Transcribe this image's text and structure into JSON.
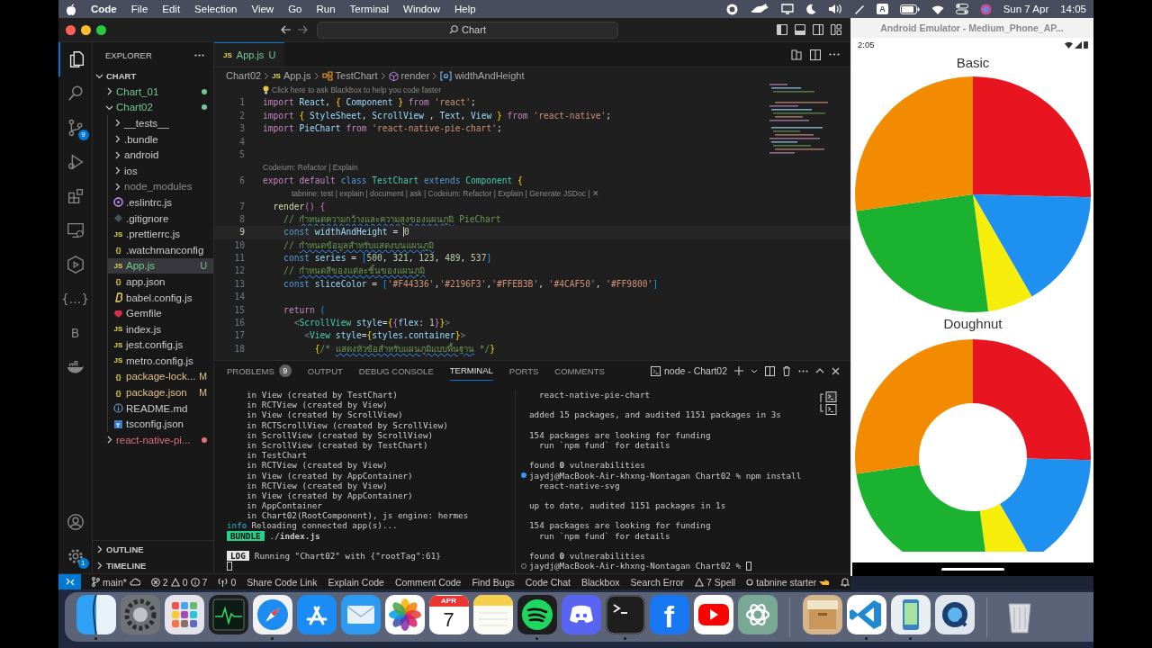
{
  "menu_bar": {
    "app": "Code",
    "items": [
      "File",
      "Edit",
      "Selection",
      "View",
      "Go",
      "Run",
      "Terminal",
      "Window",
      "Help"
    ],
    "input_source": "A",
    "date": "Sun 7 Apr",
    "time": "14:05"
  },
  "vscode": {
    "title_bar": {
      "search": "Chart"
    },
    "activity_bar": [
      {
        "kind": "explorer",
        "selected": true
      },
      {
        "kind": "search",
        "selected": false
      },
      {
        "kind": "source-control",
        "selected": false,
        "badge": "9"
      },
      {
        "kind": "run",
        "selected": false
      },
      {
        "kind": "extensions",
        "selected": false
      },
      {
        "kind": "remote",
        "selected": false
      },
      {
        "kind": "hexagon",
        "selected": false
      },
      {
        "kind": "glyph",
        "glyph": "{...}",
        "selected": false
      },
      {
        "kind": "glyph",
        "glyph": "B",
        "selected": false
      },
      {
        "kind": "docker",
        "selected": false
      }
    ],
    "activity_bottom": [
      {
        "kind": "account"
      },
      {
        "kind": "settings",
        "badge": "1"
      }
    ],
    "explorer": {
      "title": "EXPLORER",
      "section": "CHART",
      "tree": [
        {
          "label": "Chart_01",
          "kind": "folder",
          "expanded": false,
          "selected": false,
          "color": "#73c991",
          "dot": true
        },
        {
          "label": "Chart02",
          "kind": "folder",
          "expanded": true,
          "selected": false,
          "color": "#73c991",
          "dot": true,
          "children": [
            {
              "label": "__tests__",
              "kind": "folder",
              "expanded": false,
              "selected": false,
              "dot": false
            },
            {
              "label": ".bundle",
              "kind": "folder",
              "expanded": false,
              "selected": false,
              "dot": false
            },
            {
              "label": "android",
              "kind": "folder",
              "expanded": false,
              "selected": false,
              "dot": false
            },
            {
              "label": "ios",
              "kind": "folder",
              "expanded": false,
              "selected": false,
              "dot": false
            },
            {
              "label": "node_modules",
              "kind": "folder",
              "expanded": false,
              "selected": false,
              "color": "#8c8c8c",
              "dot": false
            },
            {
              "label": ".eslintrc.js",
              "kind": "eslint",
              "selected": false
            },
            {
              "label": ".gitignore",
              "kind": "gitignore",
              "selected": false
            },
            {
              "label": ".prettierrc.js",
              "kind": "js",
              "icon": "JS",
              "selected": false
            },
            {
              "label": ".watchmanconfig",
              "kind": "json",
              "icon": "{}",
              "selected": false
            },
            {
              "label": "App.js",
              "kind": "js",
              "icon": "JS",
              "selected": true,
              "color": "#73c991",
              "badge": "U"
            },
            {
              "label": "app.json",
              "kind": "json",
              "icon": "{}",
              "selected": false
            },
            {
              "label": "babel.config.js",
              "kind": "babel",
              "selected": false
            },
            {
              "label": "Gemfile",
              "kind": "gem",
              "selected": false
            },
            {
              "label": "index.js",
              "kind": "js",
              "icon": "JS",
              "selected": false
            },
            {
              "label": "jest.config.js",
              "kind": "js",
              "icon": "JS",
              "selected": false
            },
            {
              "label": "metro.config.js",
              "kind": "js",
              "icon": "JS",
              "selected": false
            },
            {
              "label": "package-lock...",
              "kind": "json",
              "icon": "{}",
              "selected": false,
              "color": "#e2c08d",
              "badge": "M"
            },
            {
              "label": "package.json",
              "kind": "json",
              "icon": "{}",
              "selected": false,
              "color": "#e2c08d",
              "badge": "M"
            },
            {
              "label": "README.md",
              "kind": "info",
              "selected": false
            },
            {
              "label": "tsconfig.json",
              "kind": "ts",
              "selected": false
            }
          ]
        },
        {
          "label": "react-native-pi...",
          "kind": "folder",
          "expanded": false,
          "selected": false,
          "color": "#e0707a",
          "dot": true
        }
      ],
      "bottom_sections": [
        {
          "label": "OUTLINE",
          "expanded": false
        },
        {
          "label": "TIMELINE",
          "expanded": false
        }
      ]
    },
    "editor": {
      "tabs": [
        {
          "label": "App.js",
          "icon": "JS",
          "badge": "U",
          "selected": true
        }
      ],
      "breadcrumb": [
        {
          "label": "Chart02",
          "kind": "folder"
        },
        {
          "label": "App.js",
          "kind": "js",
          "icon": "JS"
        },
        {
          "label": "TestChart",
          "kind": "class"
        },
        {
          "label": "render",
          "kind": "method"
        },
        {
          "label": "widthAndHeight",
          "kind": "variable"
        }
      ],
      "lines": [
        {
          "kind": "hint",
          "text": "Click here to ask Blackbox to help you code faster"
        },
        {
          "kind": "code",
          "number": "1",
          "current": false,
          "tokens": [
            {
              "kind": "kw",
              "text": "import"
            },
            {
              "kind": "id",
              "text": " React"
            },
            {
              "kind": "p",
              "text": ", "
            },
            {
              "kind": "b1",
              "text": "{"
            },
            {
              "kind": "id",
              "text": " Component "
            },
            {
              "kind": "b1",
              "text": "}"
            },
            {
              "kind": "kw",
              "text": " from "
            },
            {
              "kind": "str",
              "text": "'react'"
            },
            {
              "kind": "p",
              "text": ";"
            }
          ]
        },
        {
          "kind": "code",
          "number": "2",
          "current": false,
          "tokens": [
            {
              "kind": "kw",
              "text": "import "
            },
            {
              "kind": "b1",
              "text": "{"
            },
            {
              "kind": "id",
              "text": " StyleSheet"
            },
            {
              "kind": "p",
              "text": ", "
            },
            {
              "kind": "id",
              "text": "ScrollView"
            },
            {
              "kind": "p",
              "text": " , "
            },
            {
              "kind": "id",
              "text": "Text"
            },
            {
              "kind": "p",
              "text": ", "
            },
            {
              "kind": "id",
              "text": "View "
            },
            {
              "kind": "b1",
              "text": "}"
            },
            {
              "kind": "kw",
              "text": " from "
            },
            {
              "kind": "str",
              "text": "'react-native'"
            },
            {
              "kind": "p",
              "text": ";"
            }
          ]
        },
        {
          "kind": "code",
          "number": "3",
          "current": false,
          "tokens": [
            {
              "kind": "kw",
              "text": "import "
            },
            {
              "kind": "id",
              "text": "PieChart"
            },
            {
              "kind": "kw",
              "text": " from "
            },
            {
              "kind": "str",
              "text": "'react-native-pie-chart'"
            },
            {
              "kind": "p",
              "text": ";"
            }
          ]
        },
        {
          "kind": "code",
          "number": "4",
          "current": false
        },
        {
          "kind": "code",
          "number": "5",
          "current": false
        },
        {
          "kind": "lens",
          "indented": false,
          "text": "Codeium: Refactor | Explain"
        },
        {
          "kind": "code",
          "number": "6",
          "current": false,
          "tokens": [
            {
              "kind": "kw",
              "text": "export default "
            },
            {
              "kind": "kw2",
              "text": "class "
            },
            {
              "kind": "type",
              "text": "TestChart"
            },
            {
              "kind": "kw2",
              "text": " extends "
            },
            {
              "kind": "type",
              "text": "Component "
            },
            {
              "kind": "b1",
              "text": "{"
            }
          ]
        },
        {
          "kind": "lens",
          "indented": true,
          "text": "tabnine: test | explain | document | ask | Codeium: Refactor | Explain | Generate JSDoc | ✕"
        },
        {
          "kind": "code",
          "number": "7",
          "current": false,
          "tokens": [
            {
              "kind": "fn",
              "text": "  render"
            },
            {
              "kind": "b2",
              "text": "()"
            },
            {
              "kind": "b2",
              "text": " {"
            }
          ]
        },
        {
          "kind": "code",
          "number": "8",
          "current": false,
          "tokens": [
            {
              "kind": "cm",
              "text": "    // "
            },
            {
              "kind": "cmsp",
              "text": "กำหนดความกว้างและความสูงของแผนภูมิ"
            },
            {
              "kind": "cm",
              "text": " PieChart"
            }
          ]
        },
        {
          "kind": "code",
          "number": "9",
          "current": true,
          "tokens": [
            {
              "kind": "kw2",
              "text": "    const "
            },
            {
              "kind": "id",
              "text": "widthAndHeight"
            },
            {
              "kind": "p",
              "text": " = "
            },
            {
              "kind": "num",
              "text": "0"
            }
          ]
        },
        {
          "kind": "code",
          "number": "10",
          "current": false,
          "tokens": [
            {
              "kind": "cm",
              "text": "    // "
            },
            {
              "kind": "cmsp",
              "text": "กำหนดข้อมูลสำหรับแสดงบนแผนภูมิ"
            }
          ]
        },
        {
          "kind": "code",
          "number": "11",
          "current": false,
          "tokens": [
            {
              "kind": "kw2",
              "text": "    const "
            },
            {
              "kind": "id",
              "text": "series"
            },
            {
              "kind": "p",
              "text": " = "
            },
            {
              "kind": "b3",
              "text": "["
            },
            {
              "kind": "num",
              "text": "500"
            },
            {
              "kind": "p",
              "text": ", "
            },
            {
              "kind": "num",
              "text": "321"
            },
            {
              "kind": "p",
              "text": ", "
            },
            {
              "kind": "num",
              "text": "123"
            },
            {
              "kind": "p",
              "text": ", "
            },
            {
              "kind": "num",
              "text": "489"
            },
            {
              "kind": "p",
              "text": ", "
            },
            {
              "kind": "num",
              "text": "537"
            },
            {
              "kind": "b3",
              "text": "]"
            }
          ]
        },
        {
          "kind": "code",
          "number": "12",
          "current": false,
          "tokens": [
            {
              "kind": "cm",
              "text": "    // "
            },
            {
              "kind": "cmsp",
              "text": "กำหนดสีของแต่ละชิ้นของแผนภูมิ"
            }
          ]
        },
        {
          "kind": "code",
          "number": "13",
          "current": false,
          "tokens": [
            {
              "kind": "kw2",
              "text": "    const "
            },
            {
              "kind": "id",
              "text": "sliceColor"
            },
            {
              "kind": "p",
              "text": " = "
            },
            {
              "kind": "b3",
              "text": "["
            },
            {
              "kind": "str",
              "text": "'#F44336'"
            },
            {
              "kind": "p",
              "text": ","
            },
            {
              "kind": "str",
              "text": "'#2196F3'"
            },
            {
              "kind": "p",
              "text": ","
            },
            {
              "kind": "str",
              "text": "'#FFEB3B'"
            },
            {
              "kind": "p",
              "text": ", "
            },
            {
              "kind": "str",
              "text": "'#4CAF50'"
            },
            {
              "kind": "p",
              "text": ", "
            },
            {
              "kind": "str",
              "text": "'#FF9800'"
            },
            {
              "kind": "b3",
              "text": "]"
            }
          ]
        },
        {
          "kind": "code",
          "number": "14",
          "current": false
        },
        {
          "kind": "code",
          "number": "15",
          "current": false,
          "tokens": [
            {
              "kind": "kw",
              "text": "    return "
            },
            {
              "kind": "b3",
              "text": "("
            }
          ]
        },
        {
          "kind": "code",
          "number": "16",
          "current": false,
          "tokens": [
            {
              "kind": "tagp",
              "text": "      <"
            },
            {
              "kind": "type",
              "text": "ScrollView"
            },
            {
              "kind": "id",
              "text": " style"
            },
            {
              "kind": "p",
              "text": "="
            },
            {
              "kind": "b1",
              "text": "{"
            },
            {
              "kind": "b2",
              "text": "{"
            },
            {
              "kind": "id",
              "text": "flex"
            },
            {
              "kind": "p",
              "text": ": "
            },
            {
              "kind": "num",
              "text": "1"
            },
            {
              "kind": "b2",
              "text": "}"
            },
            {
              "kind": "b1",
              "text": "}"
            },
            {
              "kind": "tagp",
              "text": ">"
            }
          ]
        },
        {
          "kind": "code",
          "number": "17",
          "current": false,
          "tokens": [
            {
              "kind": "tagp",
              "text": "        <"
            },
            {
              "kind": "type",
              "text": "View"
            },
            {
              "kind": "id",
              "text": " style"
            },
            {
              "kind": "p",
              "text": "="
            },
            {
              "kind": "b1",
              "text": "{"
            },
            {
              "kind": "id",
              "text": "styles"
            },
            {
              "kind": "p",
              "text": "."
            },
            {
              "kind": "id",
              "text": "container"
            },
            {
              "kind": "b1",
              "text": "}"
            },
            {
              "kind": "tagp",
              "text": ">"
            }
          ]
        },
        {
          "kind": "code",
          "number": "18",
          "current": false,
          "tokens": [
            {
              "kind": "b1",
              "text": "          {"
            },
            {
              "kind": "cm",
              "text": "/* "
            },
            {
              "kind": "cmsp",
              "text": "แสดงหัวข้อสำหรับแผนภูมิแบบพื้นฐาน"
            },
            {
              "kind": "cm",
              "text": " */"
            },
            {
              "kind": "b1",
              "text": "}"
            }
          ]
        }
      ]
    },
    "panel": {
      "tabs": [
        {
          "label": "PROBLEMS",
          "badge": "9",
          "selected": false
        },
        {
          "label": "OUTPUT",
          "selected": false
        },
        {
          "label": "DEBUG CONSOLE",
          "selected": false
        },
        {
          "label": "TERMINAL",
          "selected": true
        },
        {
          "label": "PORTS",
          "selected": false
        },
        {
          "label": "COMMENTS",
          "selected": false
        }
      ],
      "terminal_name": "node - Chart02",
      "left_terminal": [
        {
          "kind": "stack",
          "text": "in View (created by TestChart)"
        },
        {
          "kind": "stack",
          "text": "in RCTView (created by View)"
        },
        {
          "kind": "stack",
          "text": "in View (created by ScrollView)"
        },
        {
          "kind": "stack",
          "text": "in RCTScrollView (created by ScrollView)"
        },
        {
          "kind": "stack",
          "text": "in ScrollView (created by ScrollView)"
        },
        {
          "kind": "stack",
          "text": "in ScrollView (created by TestChart)"
        },
        {
          "kind": "stack",
          "text": "in TestChart"
        },
        {
          "kind": "stack",
          "text": "in RCTView (created by View)"
        },
        {
          "kind": "stack",
          "text": "in View (created by AppContainer)"
        },
        {
          "kind": "stack",
          "text": "in RCTView (created by View)"
        },
        {
          "kind": "stack",
          "text": "in View (created by AppContainer)"
        },
        {
          "kind": "stack",
          "text": "in AppContainer"
        },
        {
          "kind": "stack",
          "text": "in Chart02(RootComponent), js engine: hermes"
        },
        {
          "kind": "info",
          "tag": "info",
          "text": "Reloading connected app(s)..."
        },
        {
          "kind": "bundle",
          "tag": "BUNDLE",
          "text": "./**index.js**"
        },
        {
          "kind": "blank"
        },
        {
          "kind": "log",
          "tag": "LOG",
          "text": "Running \"Chart02\" with {\"rootTag\":61}"
        },
        {
          "kind": "cursor"
        }
      ],
      "right_terminal": [
        {
          "kind": "indent",
          "text": "react-native-pie-chart"
        },
        {
          "kind": "blank"
        },
        {
          "kind": "plain",
          "text": "added 15 packages, and audited 1151 packages in 3s"
        },
        {
          "kind": "blank"
        },
        {
          "kind": "plain",
          "text": "154 packages are looking for funding"
        },
        {
          "kind": "indent",
          "text": "run `npm fund` for details"
        },
        {
          "kind": "blank"
        },
        {
          "kind": "plain",
          "text": "found **0** vulnerabilities"
        },
        {
          "kind": "prompt",
          "finished": true,
          "text": "jaydj@MacBook-Air-khxng-Nontagan Chart02 % npm install"
        },
        {
          "kind": "indent",
          "text": "react-native-svg"
        },
        {
          "kind": "blank"
        },
        {
          "kind": "plain",
          "text": "up to date, audited 1151 packages in 1s"
        },
        {
          "kind": "blank"
        },
        {
          "kind": "plain",
          "text": "154 packages are looking for funding"
        },
        {
          "kind": "indent",
          "text": "run `npm fund` for details"
        },
        {
          "kind": "blank"
        },
        {
          "kind": "plain",
          "text": "found **0** vulnerabilities"
        },
        {
          "kind": "prompt",
          "finished": false,
          "text": "jaydj@MacBook-Air-khxng-Nontagan Chart02 %"
        }
      ]
    },
    "status_bar": {
      "branch": "main*",
      "errors": "2",
      "warnings": "0",
      "infos": "7",
      "ports": "0",
      "commands": [
        "Share Code Link",
        "Explain Code",
        "Comment Code",
        "Find Bugs",
        "Code Chat",
        "Blackbox",
        "Search Error"
      ],
      "spell": "7 Spell",
      "tabnine": "tabnine starter"
    }
  },
  "emulator": {
    "title": "Android Emulator - Medium_Phone_AP...",
    "clock": "2:05",
    "charts": [
      {
        "title": "Basic",
        "kind": "pie"
      },
      {
        "title": "Doughnut",
        "kind": "donut"
      }
    ]
  },
  "dock": [
    {
      "kind": "finder",
      "running": true
    },
    {
      "kind": "settings",
      "running": false
    },
    {
      "kind": "launchpad",
      "running": false
    },
    {
      "kind": "activity",
      "running": false
    },
    {
      "kind": "safari",
      "running": true
    },
    {
      "kind": "appstore",
      "running": false
    },
    {
      "kind": "mail",
      "running": false
    },
    {
      "kind": "photos",
      "running": false
    },
    {
      "kind": "calendar",
      "month": "APR",
      "day": "7",
      "running": false
    },
    {
      "kind": "notes",
      "running": false
    },
    {
      "kind": "spotify",
      "running": true
    },
    {
      "kind": "discord",
      "running": false
    },
    {
      "kind": "terminal",
      "running": true
    },
    {
      "kind": "facebook",
      "glyph": "f",
      "running": false
    },
    {
      "kind": "youtube",
      "running": false
    },
    {
      "kind": "chatgpt",
      "running": false
    },
    {
      "kind": "separator"
    },
    {
      "kind": "archive",
      "running": false
    },
    {
      "kind": "vscode",
      "running": true
    },
    {
      "kind": "phone",
      "running": true
    },
    {
      "kind": "quicktime",
      "running": false
    },
    {
      "kind": "separator"
    },
    {
      "kind": "trash",
      "running": false
    }
  ]
}
